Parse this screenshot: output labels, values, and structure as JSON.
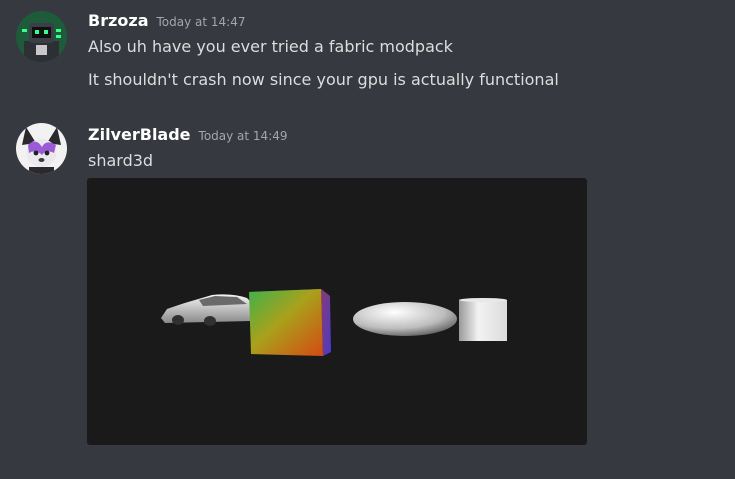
{
  "messages": [
    {
      "author": "Brzoza",
      "timestamp": "Today at 14:47",
      "lines": [
        "Also uh have you ever tried a fabric modpack",
        "It shouldn't crash now since your gpu is actually functional"
      ]
    },
    {
      "author": "ZilverBlade",
      "timestamp": "Today at 14:49",
      "lines": [
        "shard3d"
      ],
      "attachment": {
        "type": "image",
        "objects": [
          "car-model",
          "rainbow-cube",
          "ellipsoid",
          "cylinder"
        ]
      }
    }
  ],
  "colors": {
    "background": "#36393f",
    "username": "#ffffff",
    "message_text": "#dcddde",
    "timestamp": "#a3a6aa",
    "attachment_bg": "#1a1a1a"
  }
}
